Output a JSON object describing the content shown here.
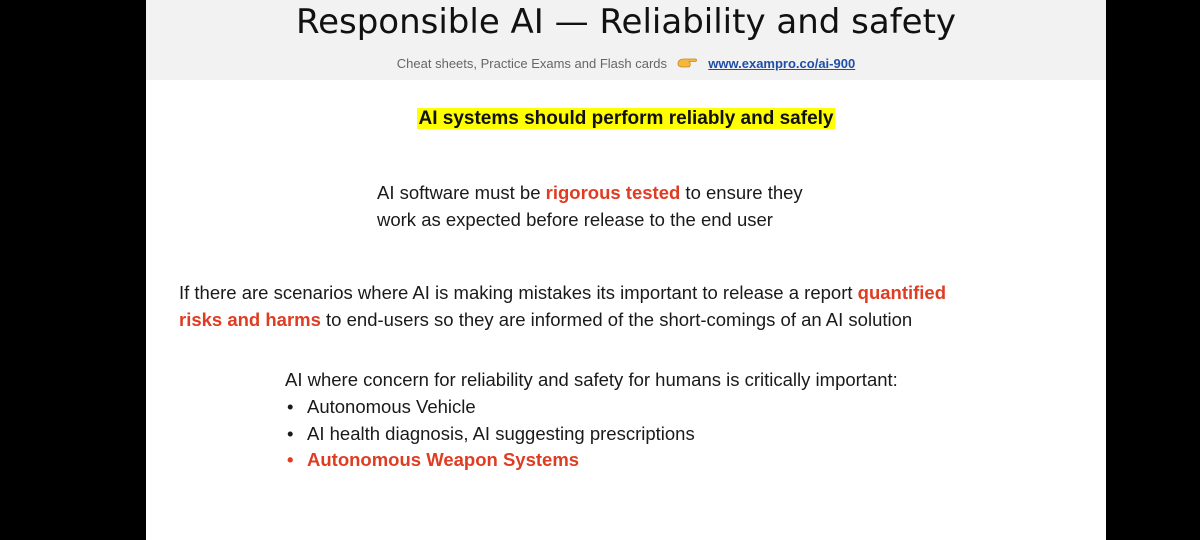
{
  "slide": {
    "title": "Responsible AI — Reliability and safety",
    "subtitle": {
      "text": "Cheat sheets, Practice Exams and Flash cards",
      "icon": "pointing-hand-icon",
      "link": "www.exampro.co/ai-900"
    },
    "highlight": "AI systems should perform reliably and safely",
    "para1": {
      "line1_pre": "AI software must be ",
      "line1_em": "rigorous tested",
      "line1_post": " to ensure they",
      "line2": "work as expected before release to the end user"
    },
    "para2": {
      "line1_pre": "If there are scenarios where AI is making mistakes its important to release a report ",
      "line1_em": "quantified",
      "line2_em": "risks and harms",
      "line2_post": " to end-users so they are informed of the short-comings of an AI solution"
    },
    "para3": {
      "intro": "AI where concern for reliability and safety for humans is critically important:",
      "bullets": [
        "Autonomous Vehicle",
        "AI health diagnosis, AI suggesting prescriptions",
        "Autonomous Weapon Systems"
      ]
    }
  },
  "colors": {
    "accent_red": "#e03c22",
    "highlight_yellow": "#ffff00",
    "link_blue": "#1f4ea8",
    "header_band": "#f2f2f2"
  }
}
